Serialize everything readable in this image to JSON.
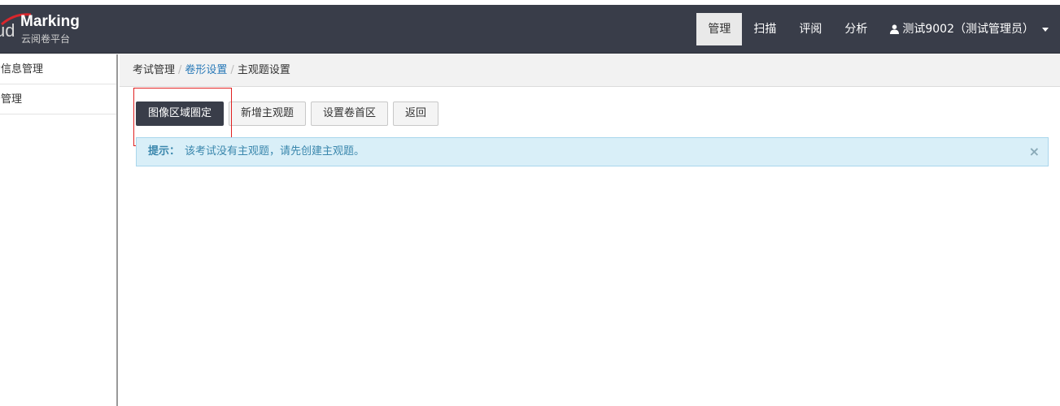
{
  "logo": {
    "cloud_text": "ud",
    "brand": "Marking",
    "subtitle": "云阅卷平台"
  },
  "nav": {
    "items": [
      {
        "label": "管理",
        "active": true
      },
      {
        "label": "扫描"
      },
      {
        "label": "评阅"
      },
      {
        "label": "分析"
      }
    ],
    "user": "测试9002（测试管理员）"
  },
  "sidebar": {
    "items": [
      {
        "label": "考信息管理"
      },
      {
        "label": "务管理"
      }
    ]
  },
  "breadcrumb": {
    "root": "考试管理",
    "middle": "卷形设置",
    "current": "主观题设置"
  },
  "toolbar": {
    "fix_region_label": "图像区域圈定",
    "add_subjective_label": "新增主观题",
    "set_header_label": "设置卷首区",
    "back_label": "返回"
  },
  "alert": {
    "label": "提示：",
    "message": "该考试没有主观题，请先创建主观题。",
    "close": "×"
  },
  "colors": {
    "navbar": "#393d49",
    "link": "#2a7ab8",
    "alert_bg": "#d9eff8",
    "highlight": "#e02020"
  }
}
